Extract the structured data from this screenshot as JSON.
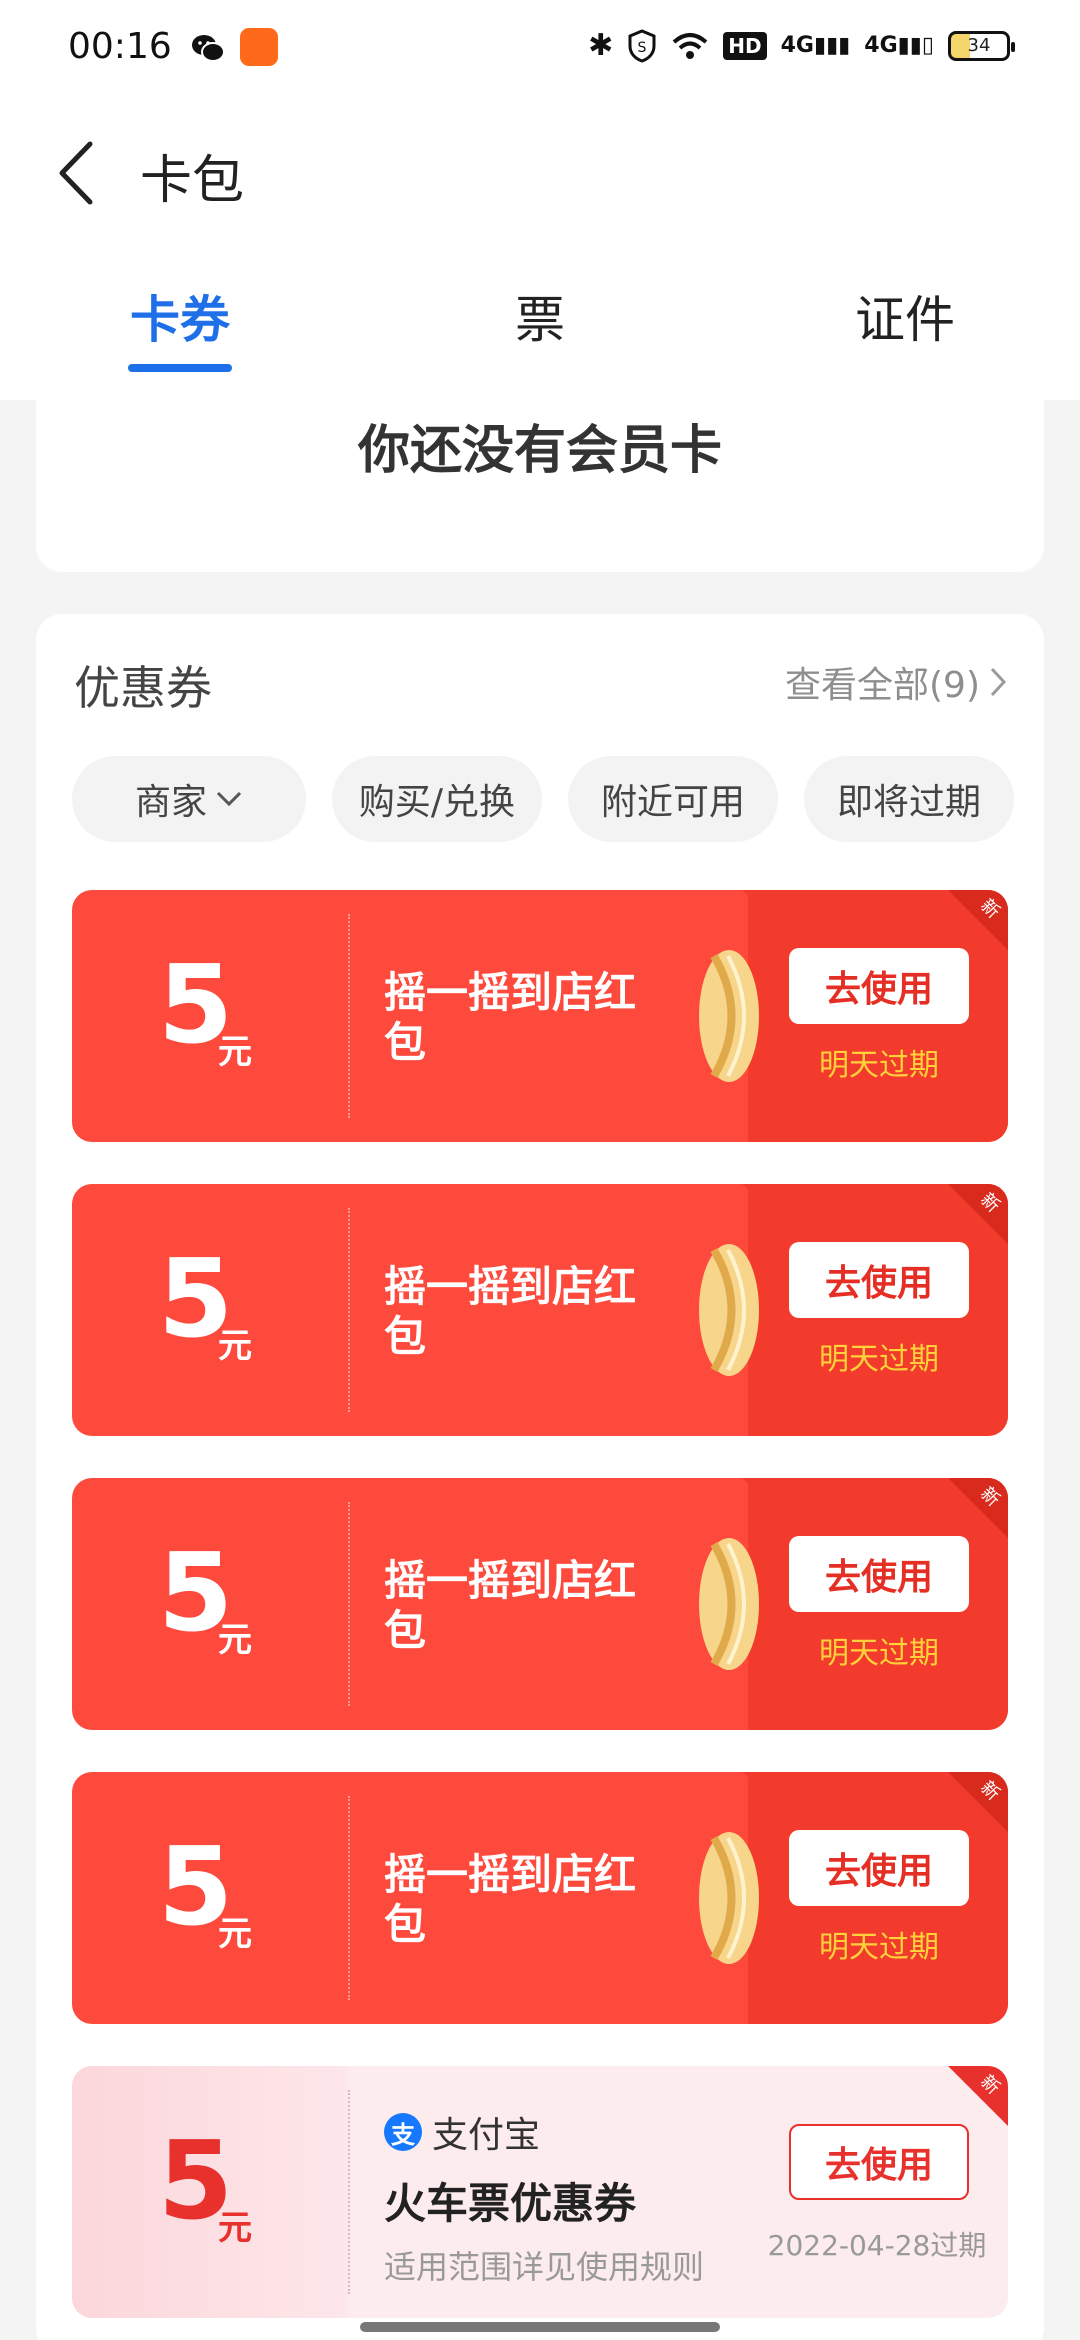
{
  "status_bar": {
    "time": "00:16",
    "battery": "34",
    "hd": "HD",
    "net": "4G"
  },
  "header": {
    "title": "卡包"
  },
  "tabs": [
    {
      "label": "卡券",
      "active": true
    },
    {
      "label": "票",
      "active": false
    },
    {
      "label": "证件",
      "active": false
    }
  ],
  "member": {
    "empty_text": "你还没有会员卡"
  },
  "coupons_section": {
    "title": "优惠券",
    "view_all": "查看全部(9)",
    "filters": [
      "商家",
      "购买/兑换",
      "附近可用",
      "即将过期"
    ]
  },
  "coupons": [
    {
      "amount": "5",
      "unit": "元",
      "name": "摇一摇到店红包",
      "button": "去使用",
      "expire": "明天过期",
      "tag": "新"
    },
    {
      "amount": "5",
      "unit": "元",
      "name": "摇一摇到店红包",
      "button": "去使用",
      "expire": "明天过期",
      "tag": "新"
    },
    {
      "amount": "5",
      "unit": "元",
      "name": "摇一摇到店红包",
      "button": "去使用",
      "expire": "明天过期",
      "tag": "新"
    },
    {
      "amount": "5",
      "unit": "元",
      "name": "摇一摇到店红包",
      "button": "去使用",
      "expire": "明天过期",
      "tag": "新"
    }
  ],
  "alipay_coupon": {
    "amount": "5",
    "unit": "元",
    "brand": "支付宝",
    "name": "火车票优惠券",
    "desc": "适用范围详见使用规则",
    "button": "去使用",
    "expire": "2022-04-28过期",
    "tag": "新"
  },
  "colors": {
    "accent": "#1f6fe8",
    "coupon_red": "#fd4a3d",
    "expire_yellow": "#ffd23a"
  }
}
